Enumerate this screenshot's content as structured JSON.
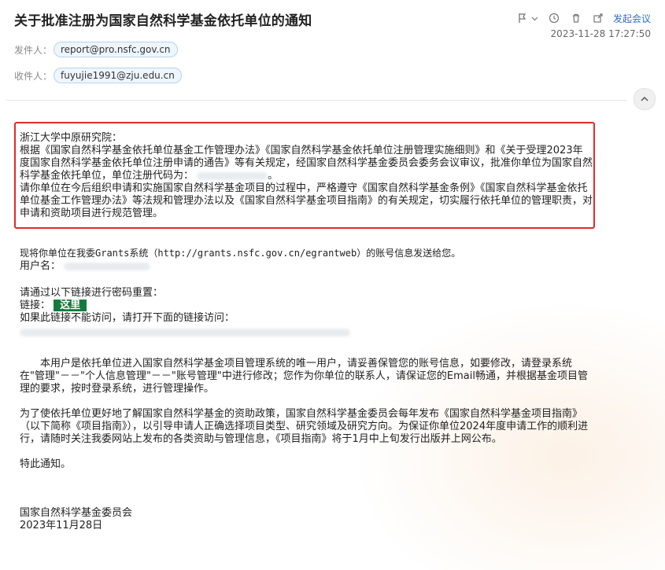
{
  "header": {
    "subject": "关于批准注册为国家自然科学基金依托单位的通知",
    "datetime": "2023-11-28 17:27:50",
    "meeting_link": "发起会议",
    "icons": [
      "flag-icon",
      "chevron-down-icon",
      "clock-icon",
      "trash-icon",
      "export-icon"
    ]
  },
  "meta": {
    "from_label": "发件人：",
    "from_addr": "report@pro.nsfc.gov.cn",
    "to_label": "收件人：",
    "to_addr": "fuyujie1991@zju.edu.cn"
  },
  "body": {
    "highlight": [
      "浙江大学中原研究院：",
      "根据《国家自然科学基金依托单位基金工作管理办法》《国家自然科学基金依托单位注册管理实施细则》和《关于受理2023年度国家自然科学基金依托单位注册申请的通告》等有关规定，经国家自然科学基金委员会委务会议审议，批准你单位为国家自然科学基金依托单位，单位注册代码为：",
      "请你单位在今后组织申请和实施国家自然科学基金项目的过程中，严格遵守《国家自然科学基金条例》《国家自然科学基金依托单位基金工作管理办法》等法规和管理办法以及《国家自然科学基金项目指南》的有关规定，切实履行依托单位的管理职责，对申请和资助项目进行规范管理。"
    ],
    "account_intro": "现将你单位在我委Grants系统（http://grants.nsfc.gov.cn/egrantweb）的账号信息发送给您。",
    "username_label": "用户名：",
    "reset_intro": "请通过以下链接进行密码重置：",
    "link_label": "链接：",
    "link_button": "这里",
    "link_fallback": "如果此链接不能访问，请打开下面的链接访问：",
    "user_notice": "本用户是依托单位进入国家自然科学基金项目管理系统的唯一用户，请妥善保管您的账号信息，如要修改，请登录系统在\"管理\"－－\"个人信息管理\"－－\"账号管理\"中进行修改；您作为你单位的联系人，请保证您的Email畅通，并根据基金项目管理的要求，按时登录系统，进行管理操作。",
    "guide_notice": "为了使依托单位更好地了解国家自然科学基金的资助政策，国家自然科学基金委员会每年发布《国家自然科学基金项目指南》（以下简称《项目指南》），以引导申请人正确选择项目类型、研究领域及研究方向。为保证你单位2024年度申请工作的顺利进行，请随时关注我委网站上发布的各类资助与管理信息，《项目指南》将于1月中上旬发行出版并上网公布。",
    "closing": "特此通知。",
    "signature_org": "国家自然科学基金委员会",
    "signature_date": "2023年11月28日"
  }
}
